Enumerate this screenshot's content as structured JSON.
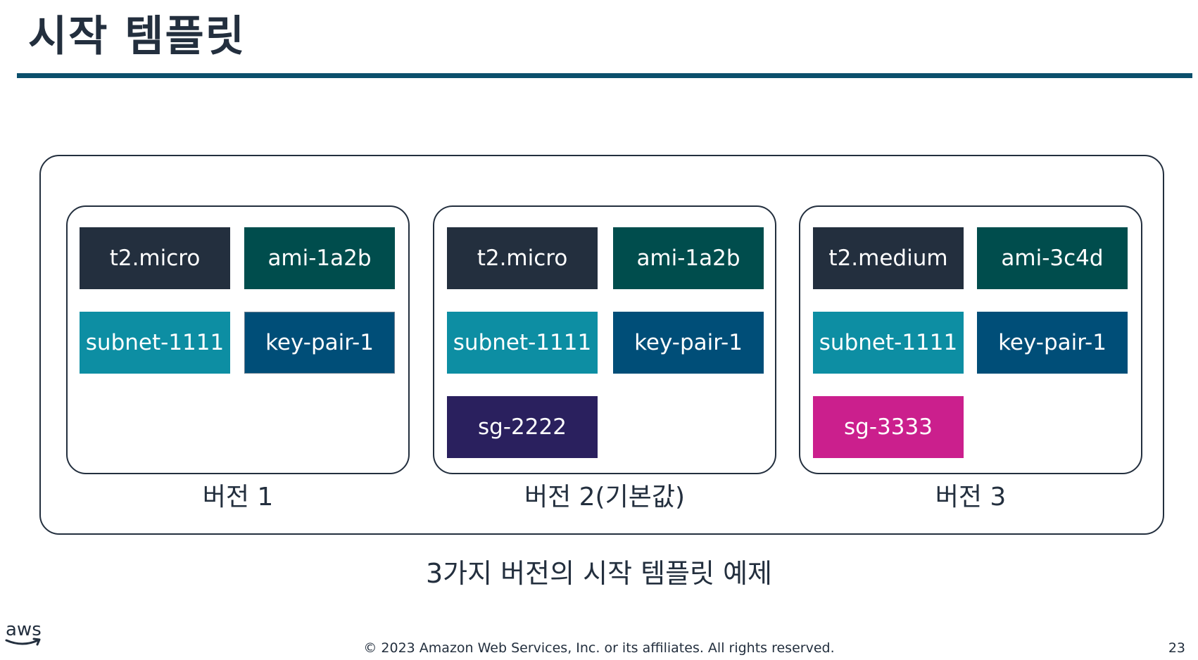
{
  "slide": {
    "title": "시작 템플릿",
    "caption": "3가지 버전의 시작 템플릿 예제",
    "copyright": "© 2023 Amazon Web Services, Inc. or its affiliates. All rights reserved.",
    "page_number": "23",
    "logo_text": "aws"
  },
  "colors": {
    "instance_type": "#232f3e",
    "ami": "#004d4d",
    "subnet": "#0d8ea3",
    "key_pair": "#004e78",
    "sg_2222": "#2a205e",
    "sg_3333": "#cb1f8d",
    "rule": "#0b4f6c"
  },
  "versions": [
    {
      "label": "버전 1",
      "tiles": {
        "instance_type": "t2.micro",
        "ami": "ami-1a2b",
        "subnet": "subnet-1111",
        "key_pair": "key-pair-1"
      }
    },
    {
      "label": "버전 2(기본값)",
      "tiles": {
        "instance_type": "t2.micro",
        "ami": "ami-1a2b",
        "subnet": "subnet-1111",
        "key_pair": "key-pair-1",
        "security_group": "sg-2222"
      }
    },
    {
      "label": "버전 3",
      "tiles": {
        "instance_type": "t2.medium",
        "ami": "ami-3c4d",
        "subnet": "subnet-1111",
        "key_pair": "key-pair-1",
        "security_group": "sg-3333"
      }
    }
  ]
}
